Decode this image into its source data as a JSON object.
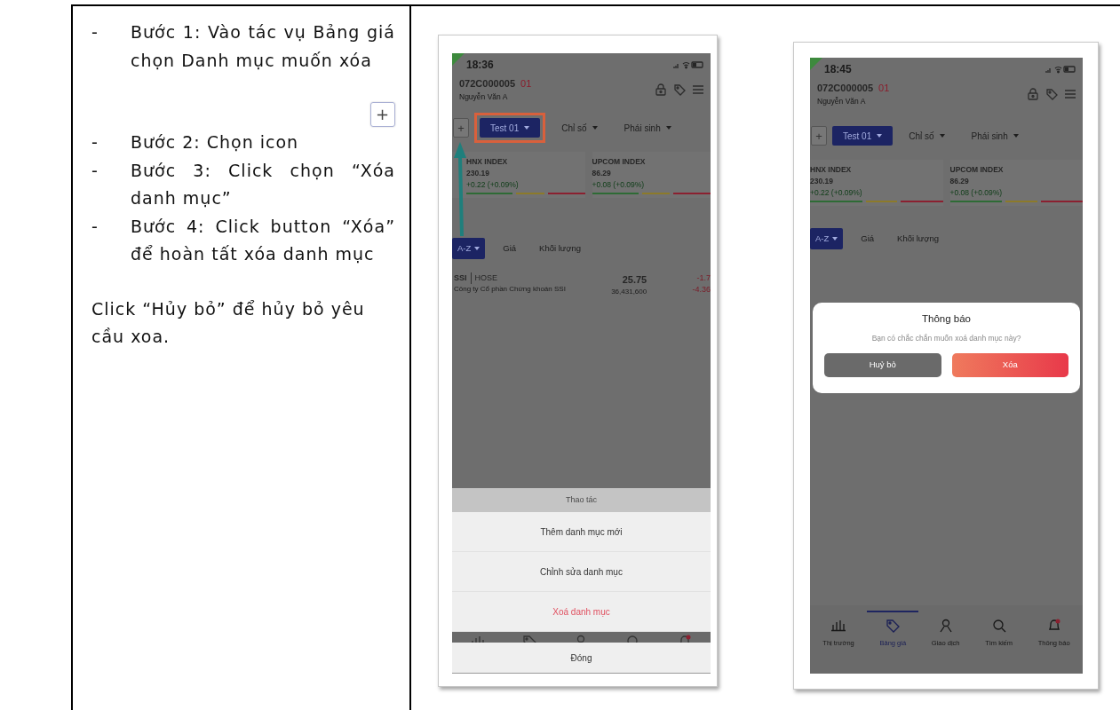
{
  "instructions": {
    "steps": [
      {
        "marker": "-",
        "text": "Bước 1: Vào tác vụ Bảng giá chọn Danh mục muốn xóa"
      },
      {
        "marker": "-",
        "text": "Bước 2: Chọn icon",
        "icon": "+"
      },
      {
        "marker": "-",
        "text": "Bước 3: Click chọn “Xóa danh mục”"
      },
      {
        "marker": "-",
        "text": "Bước 4: Click button “Xóa” để hoàn tất xóa danh mục"
      }
    ],
    "note": "Click “Hủy bỏ” để hủy bỏ yêu cầu xoa."
  },
  "phones": [
    {
      "time": "18:36",
      "account": "072C000005",
      "sub_account": "01",
      "holder": "Nguyễn Văn A",
      "add_label": "+",
      "tabs": [
        {
          "label": "Test 01",
          "selected": true,
          "highlighted": true
        },
        {
          "label": "Chỉ số",
          "selected": false,
          "highlighted": false
        },
        {
          "label": "Phái sinh",
          "selected": false,
          "highlighted": false
        }
      ],
      "indices": [
        {
          "name": "HNX INDEX",
          "value": "230.19",
          "change": "+0.22 (+0.09%)"
        },
        {
          "name": "UPCOM INDEX",
          "value": "86.29",
          "change": "+0.08 (+0.09%)"
        }
      ],
      "sort_tabs": [
        {
          "label": "A-Z",
          "selected": true
        },
        {
          "label": "Giá",
          "selected": false
        },
        {
          "label": "Khối lượng",
          "selected": false
        }
      ],
      "stocks": [
        {
          "symbol": "SSI",
          "exchange": "HOSE",
          "company": "Công ty Cổ phần Chứng khoán SSI",
          "price": "25.75",
          "volume": "36,431,600",
          "change": "-1.7",
          "change_pct": "-4.36"
        }
      ],
      "pointer_arrow": true,
      "tab_bar": [
        {
          "kind": "chart"
        },
        {
          "kind": "tag"
        },
        {
          "kind": "person"
        },
        {
          "kind": "search"
        },
        {
          "kind": "bell"
        }
      ],
      "action_sheet": {
        "title": "Thao tác",
        "items": [
          {
            "label": "Thêm danh mục mới",
            "kind": "normal"
          },
          {
            "label": "Chỉnh sửa danh mục",
            "kind": "normal"
          },
          {
            "label": "Xoá danh mục",
            "kind": "danger"
          }
        ],
        "close": "Đóng"
      }
    },
    {
      "time": "18:45",
      "account": "072C000005",
      "sub_account": "01",
      "holder": "Nguyễn Văn A",
      "add_label": "+",
      "tabs": [
        {
          "label": "Test 01",
          "selected": true,
          "highlighted": false
        },
        {
          "label": "Chỉ số",
          "selected": false,
          "highlighted": false
        },
        {
          "label": "Phái sinh",
          "selected": false,
          "highlighted": false
        }
      ],
      "indices": [
        {
          "name": "HNX INDEX",
          "value": "230.19",
          "change": "+0.22 (+0.09%)"
        },
        {
          "name": "UPCOM INDEX",
          "value": "86.29",
          "change": "+0.08 (+0.09%)"
        }
      ],
      "sort_tabs": [
        {
          "label": "A-Z",
          "selected": true
        },
        {
          "label": "Giá",
          "selected": false
        },
        {
          "label": "Khối lượng",
          "selected": false
        }
      ],
      "dialog": {
        "title": "Thông báo",
        "message": "Bạn có chắc chắn muốn xoá danh mục này?",
        "buttons": [
          {
            "label": "Huỷ bỏ",
            "kind": "cancel"
          },
          {
            "label": "Xóa",
            "kind": "danger"
          }
        ]
      },
      "tab_bar": [
        {
          "kind": "chart",
          "label": "Thị trường",
          "selected": false
        },
        {
          "kind": "tag",
          "label": "Bảng giá",
          "selected": true
        },
        {
          "kind": "person",
          "label": "Giao dịch",
          "selected": false
        },
        {
          "kind": "search",
          "label": "Tìm kiếm",
          "selected": false
        },
        {
          "kind": "bell",
          "label": "Thông báo",
          "selected": false
        }
      ]
    }
  ]
}
